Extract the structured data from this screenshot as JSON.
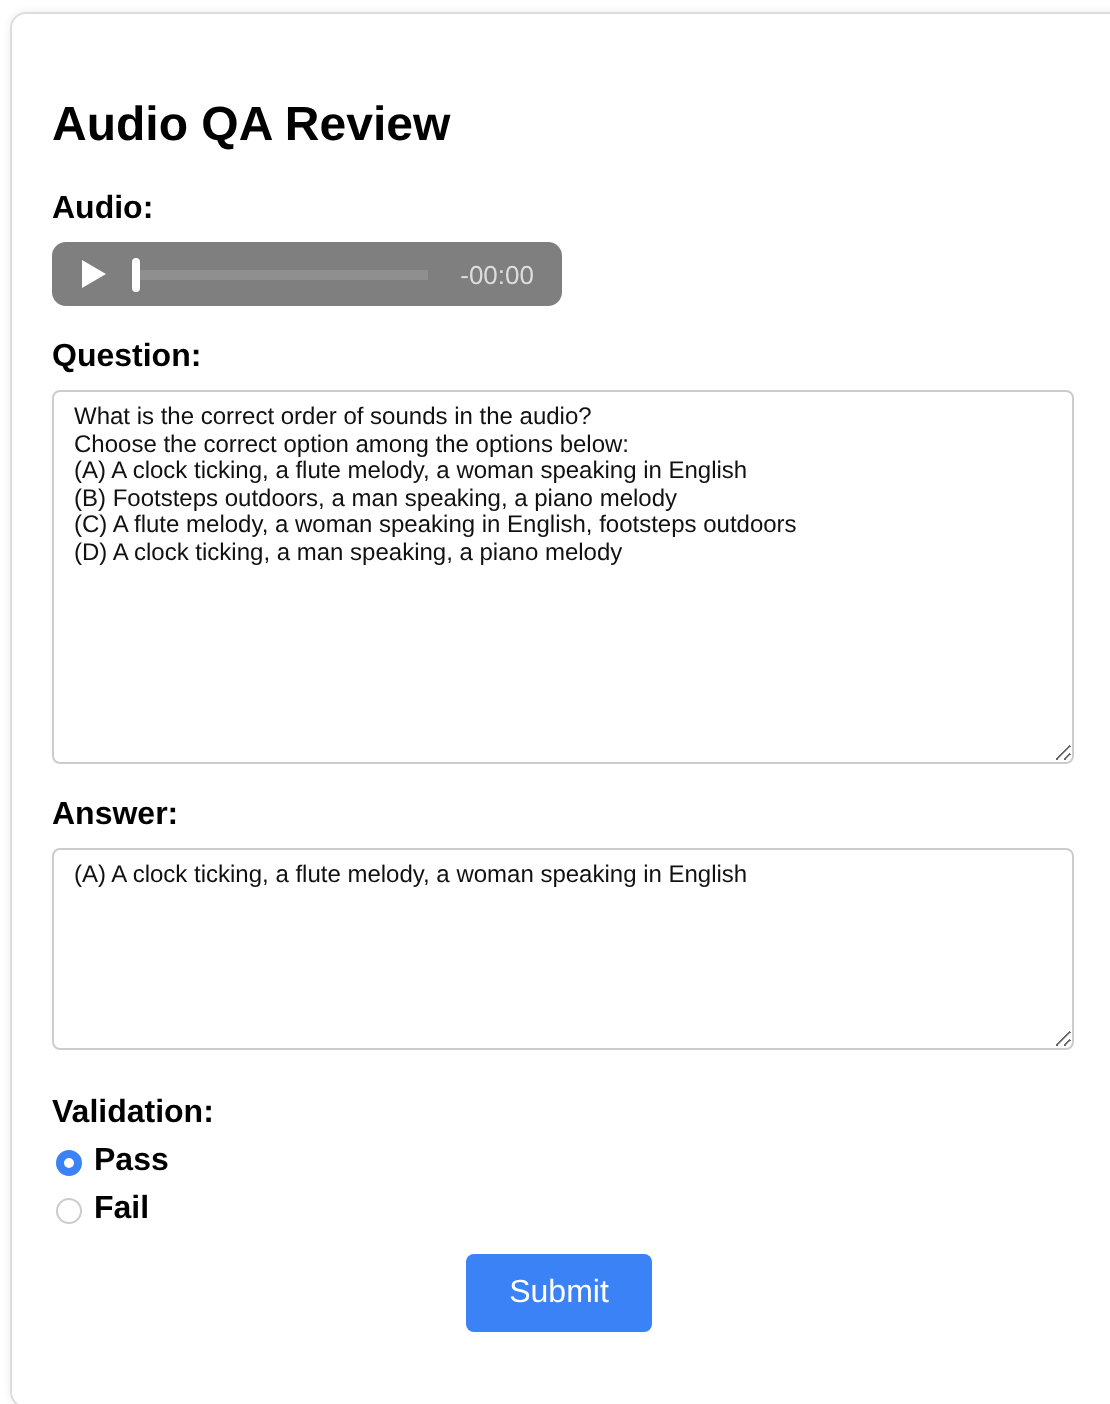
{
  "title": "Audio QA Review",
  "audio": {
    "label": "Audio:",
    "time": "-00:00",
    "level": 0
  },
  "question": {
    "label": "Question:",
    "value": "What is the correct order of sounds in the audio?\nChoose the correct option among the options below:\n(A) A clock ticking, a flute melody, a woman speaking in English\n(B) Footsteps outdoors, a man speaking, a piano melody\n(C) A flute melody, a woman speaking in English, footsteps outdoors\n(D) A clock ticking, a man speaking, a piano melody"
  },
  "answer": {
    "label": "Answer:",
    "value": "(A) A clock ticking, a flute melody, a woman speaking in English"
  },
  "validation": {
    "label": "Validation:",
    "options": [
      {
        "label": "Pass",
        "selected": true
      },
      {
        "label": "Fail",
        "selected": false
      }
    ]
  },
  "submit": "Submit"
}
